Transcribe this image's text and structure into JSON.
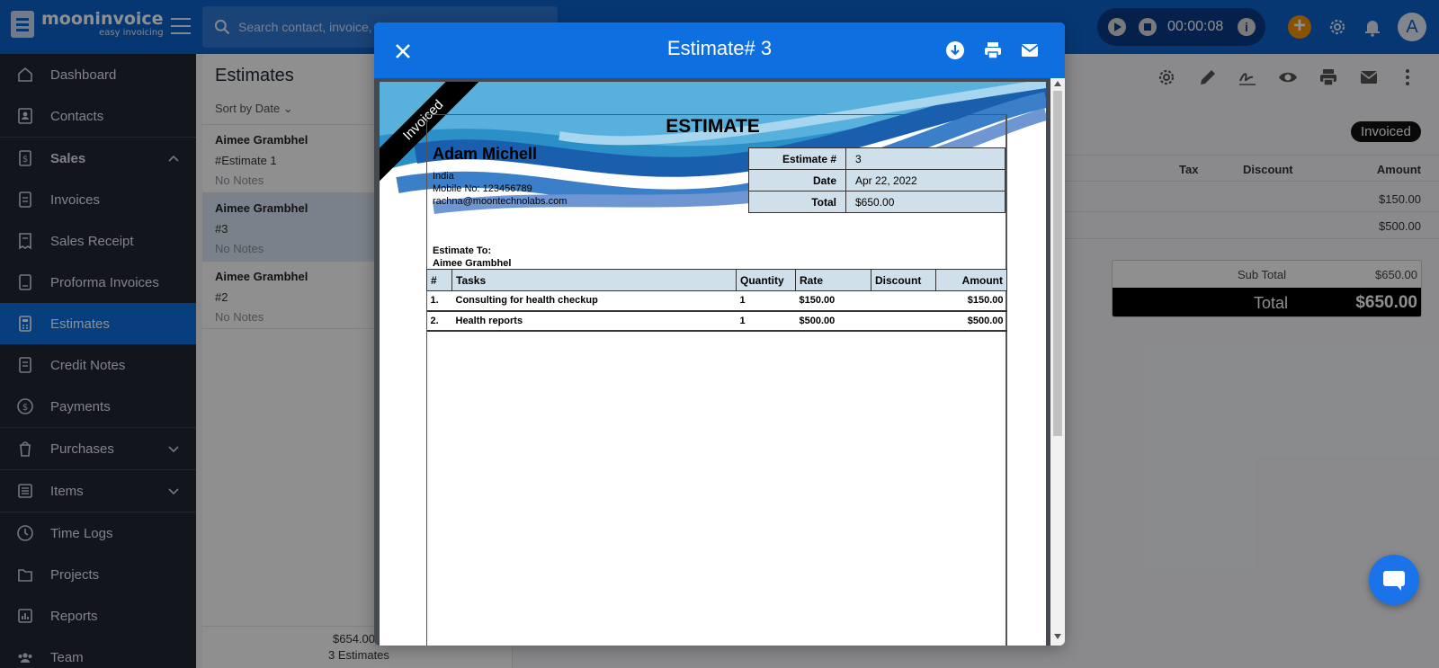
{
  "app": {
    "name": "mooninvoice",
    "tagline": "easy invoicing"
  },
  "search": {
    "placeholder": "Search contact, invoice, est"
  },
  "timer": {
    "time": "00:00:08"
  },
  "avatar": {
    "initial": "A"
  },
  "sidebar": {
    "items": [
      {
        "label": "Dashboard",
        "icon": "home-icon"
      },
      {
        "label": "Contacts",
        "icon": "contacts-icon"
      },
      {
        "label": "Sales",
        "icon": "sales-icon"
      },
      {
        "label": "Invoices",
        "icon": "invoice-icon"
      },
      {
        "label": "Sales Receipt",
        "icon": "receipt-icon"
      },
      {
        "label": "Proforma Invoices",
        "icon": "proforma-icon"
      },
      {
        "label": "Estimates",
        "icon": "estimates-icon"
      },
      {
        "label": "Credit Notes",
        "icon": "credit-notes-icon"
      },
      {
        "label": "Payments",
        "icon": "payments-icon"
      },
      {
        "label": "Purchases",
        "icon": "purchases-icon"
      },
      {
        "label": "Items",
        "icon": "items-icon"
      },
      {
        "label": "Time Logs",
        "icon": "clock-icon"
      },
      {
        "label": "Projects",
        "icon": "folder-icon"
      },
      {
        "label": "Reports",
        "icon": "reports-icon"
      },
      {
        "label": "Team",
        "icon": "team-icon"
      }
    ]
  },
  "estimates_list": {
    "title": "Estimates",
    "sort_label": "Sort by Date",
    "items": [
      {
        "name": "Aimee Grambhel",
        "number": "#Estimate 1",
        "notes": "No Notes"
      },
      {
        "name": "Aimee Grambhel",
        "number": "#3",
        "notes": "No Notes"
      },
      {
        "name": "Aimee Grambhel",
        "number": "#2",
        "notes": "No Notes"
      }
    ],
    "footer_total": "$654.00",
    "footer_count": "3 Estimates"
  },
  "detail": {
    "status": "Invoiced",
    "columns": [
      "Tax",
      "Discount",
      "Amount"
    ],
    "rows": [
      {
        "amount": "$150.00"
      },
      {
        "amount": "$500.00"
      }
    ],
    "sub_total_label": "Sub Total",
    "sub_total": "$650.00",
    "total_label": "Total",
    "total": "$650.00"
  },
  "modal": {
    "title": "Estimate# 3",
    "document": {
      "ribbon": "Invoiced",
      "heading": "ESTIMATE",
      "from": {
        "name": "Adam Michell",
        "country": "India",
        "mobile": "Mobile No: 123456789",
        "email": "rachna@moontechnolabs.com"
      },
      "meta": [
        {
          "key": "Estimate #",
          "value": "3"
        },
        {
          "key": "Date",
          "value": "Apr 22, 2022"
        },
        {
          "key": "Total",
          "value": "$650.00"
        }
      ],
      "to_label": "Estimate To:",
      "to_name": "Aimee Grambhel",
      "columns": [
        "#",
        "Tasks",
        "Quantity",
        "Rate",
        "Discount",
        "Amount"
      ],
      "items": [
        {
          "no": "1.",
          "task": "Consulting for health checkup",
          "qty": "1",
          "rate": "$150.00",
          "discount": "",
          "amount": "$150.00"
        },
        {
          "no": "2.",
          "task": "Health reports",
          "qty": "1",
          "rate": "$500.00",
          "discount": "",
          "amount": "$500.00"
        }
      ]
    }
  },
  "colors": {
    "primary": "#0d6fe0",
    "topbar": "#0b63ce",
    "sidebar": "#202733",
    "accent": "#f39200",
    "meta_fill": "#cfe0ea"
  }
}
